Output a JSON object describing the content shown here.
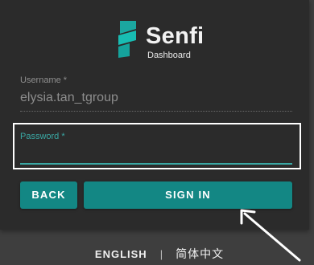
{
  "brand": {
    "name": "Senfi",
    "subtitle": "Dashboard"
  },
  "form": {
    "username": {
      "label": "Username *",
      "value": "elysia.tan_tgroup"
    },
    "password": {
      "label": "Password *",
      "value": ""
    },
    "back_label": "BACK",
    "signin_label": "SIGN IN"
  },
  "languages": {
    "english": "ENGLISH",
    "separator": "|",
    "chinese": "简体中文"
  },
  "colors": {
    "accent": "#138784",
    "field_focus": "#3aa8a4",
    "card_background": "#2b2b2b",
    "page_background": "#3e3e3e",
    "annotation": "#ffffff"
  },
  "icons": {
    "logo": "senfi-logo-icon",
    "annotation_arrow": "arrow-icon"
  }
}
